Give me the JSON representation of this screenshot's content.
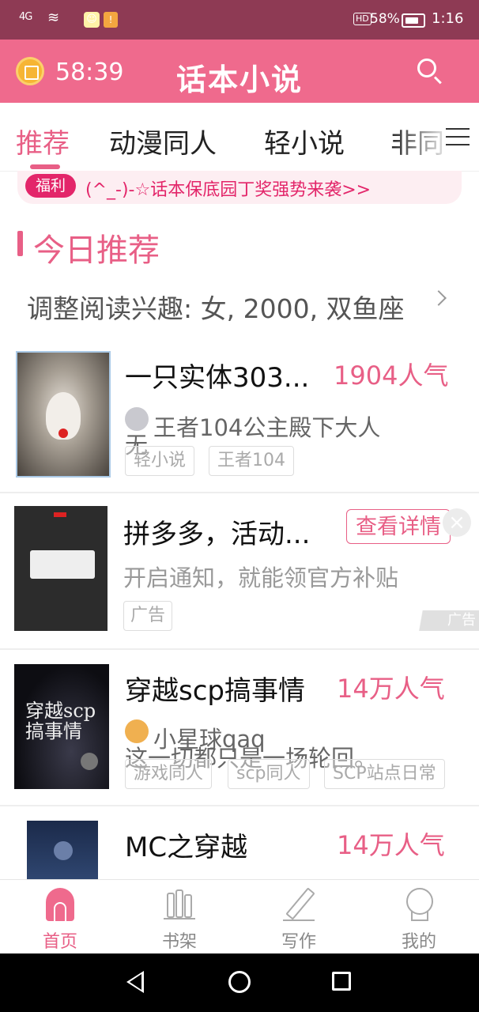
{
  "status_bar": {
    "signal": "4G",
    "battery_label": "HD",
    "battery": "58%",
    "time": "1:16"
  },
  "header": {
    "timer": "58:39",
    "title": "话本小说"
  },
  "tabs": [
    {
      "label": "推荐",
      "active": true
    },
    {
      "label": "动漫同人"
    },
    {
      "label": "轻小说"
    },
    {
      "label": "非同"
    }
  ],
  "notice": {
    "badge": "福利",
    "text": "(^_-)-☆话本保底园丁奖强势来袭>>"
  },
  "section": {
    "title": "今日推荐",
    "preference": "调整阅读兴趣: 女, 2000, 双鱼座"
  },
  "books": [
    {
      "title": "一只实体303...",
      "popularity": "1904人气",
      "author": "王者104公主殿下大人",
      "desc": "无",
      "tags": [
        "轻小说",
        "王者104"
      ]
    },
    {
      "title": "穿越scp搞事情",
      "popularity": "14万人气",
      "author": "小星球qaq",
      "desc": "这一切都只是一场轮回。",
      "tags": [
        "游戏同人",
        "scp同人",
        "SCP站点日常"
      ],
      "cover_text": "穿越scp搞事情"
    },
    {
      "title": "MC之穿越",
      "popularity": "14万人气"
    }
  ],
  "ad": {
    "title": "拼多多，活动...",
    "button": "查看详情",
    "desc": "开启通知，就能领官方补贴",
    "tag": "广告",
    "mark": "广告",
    "close": "×"
  },
  "bottom_nav": [
    {
      "label": "首页",
      "active": true,
      "icon": "home-icon"
    },
    {
      "label": "书架",
      "icon": "bookshelf-icon"
    },
    {
      "label": "写作",
      "icon": "pen-icon"
    },
    {
      "label": "我的",
      "icon": "profile-icon"
    }
  ],
  "colors": {
    "accent": "#e85f86",
    "header": "#ef6a8d",
    "statusbar": "#8e3a54"
  }
}
